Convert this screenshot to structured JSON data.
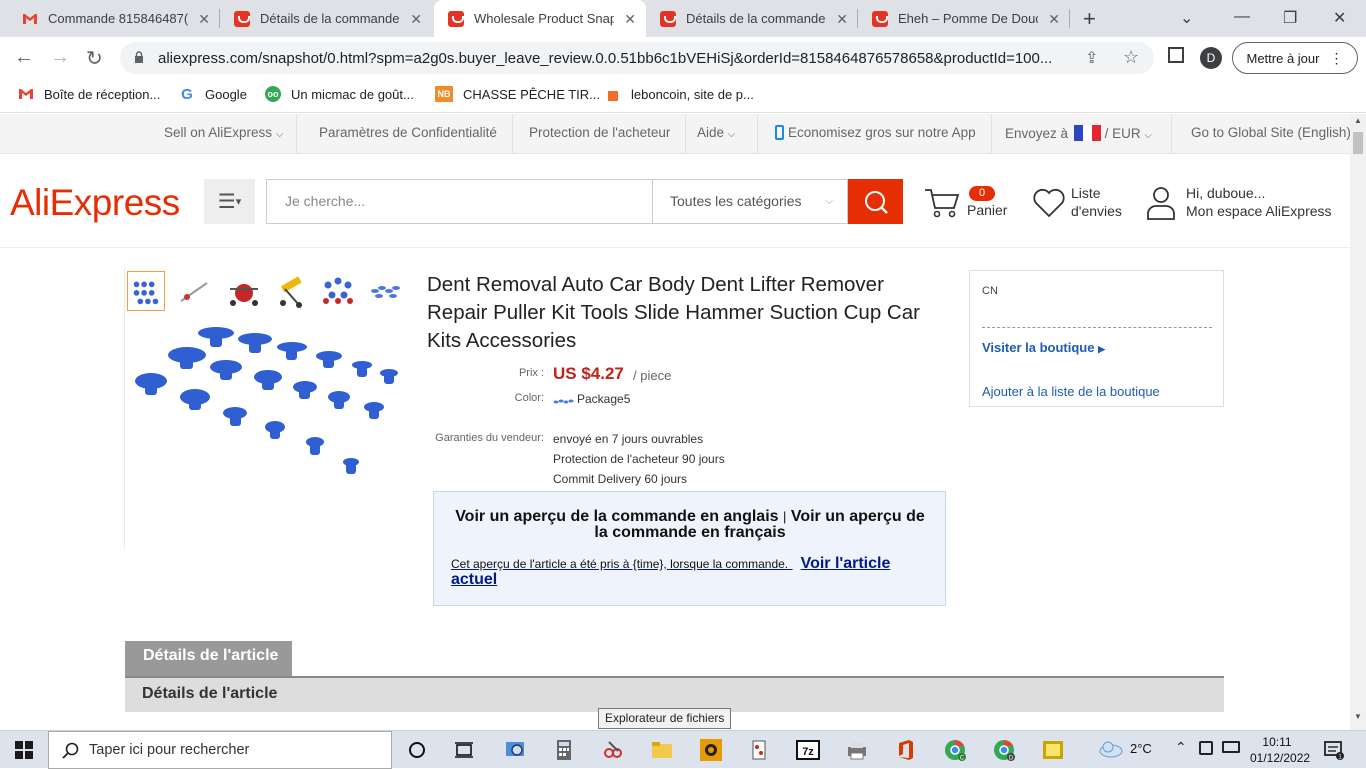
{
  "browser": {
    "tabs": [
      {
        "title": "Commande 815846487(",
        "favicon": "gmail-icon",
        "active": false
      },
      {
        "title": "Détails de la commande",
        "favicon": "aliexpress-icon",
        "active": false
      },
      {
        "title": "Wholesale Product Snap",
        "favicon": "aliexpress-icon",
        "active": true
      },
      {
        "title": "Détails de la commande",
        "favicon": "aliexpress-icon",
        "active": false
      },
      {
        "title": "Eheh – Pomme De Douc",
        "favicon": "aliexpress-icon",
        "active": false
      }
    ],
    "url": "aliexpress.com/snapshot/0.html?spm=a2g0s.buyer_leave_review.0.0.51bb6c1bVEHiSj&orderId=8158464876578658&productId=100...",
    "avatar_letter": "D",
    "update_label": "Mettre à jour",
    "bookmarks": [
      {
        "label": "Boîte de réception...",
        "icon": "gmail-icon"
      },
      {
        "label": "Google",
        "icon": "google-icon"
      },
      {
        "label": "Un micmac de goût...",
        "icon": "tripadvisor-icon"
      },
      {
        "label": "CHASSE PÊCHE TIR...",
        "icon": "nb-icon"
      },
      {
        "label": "leboncoin, site de p...",
        "icon": "leboncoin-icon"
      }
    ]
  },
  "site": {
    "topbar": {
      "sell": "Sell on AliExpress",
      "privacy": "Paramètres de Confidentialité",
      "protection": "Protection de l'acheteur",
      "help": "Aide",
      "app": "Economisez gros sur notre App",
      "ship_to": "Envoyez à",
      "currency": "EUR",
      "global": "Go to Global Site (English)"
    },
    "header": {
      "logo": "AliExpress",
      "search_placeholder": "Je cherche...",
      "category": "Toutes les catégories",
      "cart_count": "0",
      "cart_label": "Panier",
      "wishlist_line1": "Liste",
      "wishlist_line2": "d'envies",
      "greeting": "Hi, duboue...",
      "account": "Mon espace AliExpress"
    }
  },
  "product": {
    "title": "Dent Removal Auto Car Body Dent Lifter Remover Repair Puller Kit Tools Slide Hammer Suction Cup Car Kits Accessories",
    "price_label": "Prix :",
    "price": "US $4.27",
    "unit": "/ piece",
    "color_label": "Color:",
    "color_value": "Package5",
    "guarantee_label": "Garanties du vendeur:",
    "guarantees": [
      "envoyé en 7 jours ouvrables",
      "Protection de l'acheteur 90 jours",
      "Commit Delivery 60 jours"
    ]
  },
  "snapshot": {
    "heading_en": "Voir un aperçu de la commande en anglais",
    "heading_sep": "|",
    "heading_fr": "Voir un aperçu de la commande en français",
    "note": "Cet aperçu de l'article a été pris à {time}, lorsque la commande.",
    "link": "Voir l'article actuel"
  },
  "store": {
    "country": "CN",
    "visit": "Visiter la boutique",
    "follow": "Ajouter à la liste de la boutique"
  },
  "details": {
    "tab_label": "Détails de l'article",
    "bar_label": "Détails de l'article"
  },
  "tooltip": "Explorateur de fichiers",
  "taskbar": {
    "search_placeholder": "Taper ici pour rechercher",
    "temperature": "2°C",
    "time": "10:11",
    "date": "01/12/2022"
  },
  "colors": {
    "ali_red": "#e62e04",
    "price_red": "#c1221a",
    "link_blue": "#1e5cb3"
  }
}
